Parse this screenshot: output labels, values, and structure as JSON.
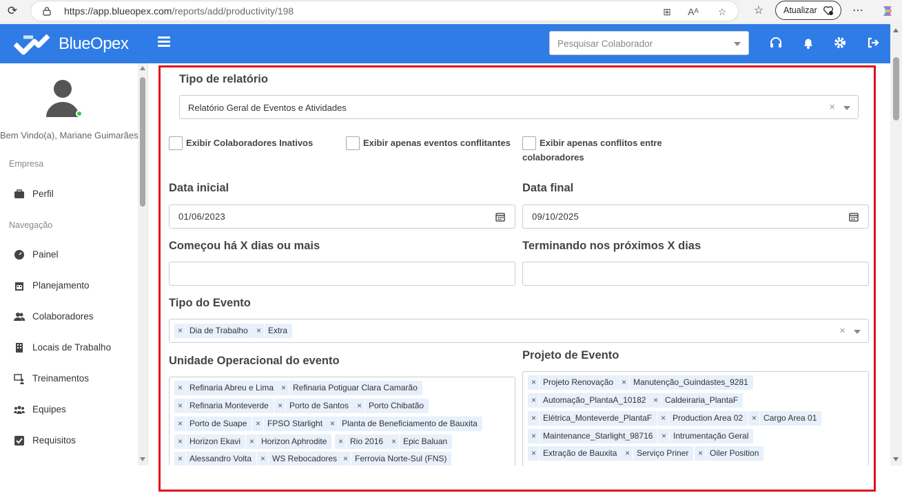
{
  "browser": {
    "url_host": "https://app.blueopex.com",
    "url_path": "/reports/add/productivity/198",
    "update_label": "Atualizar"
  },
  "header": {
    "brand": "BlueOpex",
    "search_placeholder": "Pesquisar Colaborador",
    "brand_color": "#2f7ce6"
  },
  "sidebar": {
    "welcome": "Bem Vindo(a), Mariane Guimarães",
    "section_company": "Empresa",
    "section_nav": "Navegação",
    "items": [
      {
        "label": "Perfil",
        "icon": "briefcase-icon"
      },
      {
        "label": "Painel",
        "icon": "dashboard-icon"
      },
      {
        "label": "Planejamento",
        "icon": "calendar-icon"
      },
      {
        "label": "Colaboradores",
        "icon": "users-icon"
      },
      {
        "label": "Locais de Trabalho",
        "icon": "building-icon"
      },
      {
        "label": "Treinamentos",
        "icon": "training-icon"
      },
      {
        "label": "Equipes",
        "icon": "team-icon"
      },
      {
        "label": "Requisitos",
        "icon": "checkbox-icon"
      }
    ]
  },
  "form": {
    "report_type_label": "Tipo de relatório",
    "report_type_value": "Relatório Geral de Eventos e Atividades",
    "checkboxes": [
      {
        "label": "Exibir Colaboradores Inativos",
        "checked": false
      },
      {
        "label": "Exibir apenas eventos conflitantes",
        "checked": false
      },
      {
        "label": "Exibir apenas conflitos entre colaboradores",
        "checked": false
      }
    ],
    "start_date_label": "Data inicial",
    "start_date_value": "01/06/2023",
    "end_date_label": "Data final",
    "end_date_value": "09/10/2025",
    "started_days_label": "Começou há X dias ou mais",
    "started_days_value": "",
    "ending_days_label": "Terminando nos próximos X dias",
    "ending_days_value": "",
    "event_type_label": "Tipo do Evento",
    "event_types": [
      "Dia de Trabalho",
      "Extra"
    ],
    "unit_label": "Unidade Operacional do evento",
    "units": [
      "Refinaria Abreu e Lima",
      "Refinaria Potiguar Clara Camarão",
      "Refinaria Monteverde",
      "Porto de Santos",
      "Porto Chibatão",
      "Porto de Suape",
      "FPSO Starlight",
      "Planta de Beneficiamento de Bauxita",
      "Horizon Ekavi",
      "Horizon Aphrodite",
      "Rio 2016",
      "Epic Baluan",
      "Alessandro Volta",
      "WS Rebocadores",
      "Ferrovia Norte-Sul (FNS)"
    ],
    "project_label": "Projeto de Evento",
    "projects": [
      "Projeto Renovação",
      "Manutenção_Guindastes_9281",
      "Automação_PlantaA_10182",
      "Caldeiraria_PlantaF",
      "Elétrica_Monteverde_PlantaF",
      "Production Area 02",
      "Cargo Area 01",
      "Maintenance_Starlight_98716",
      "Intrumentação Geral",
      "Extração de Bauxita",
      "Serviço Priner",
      "Oiler Position"
    ]
  }
}
